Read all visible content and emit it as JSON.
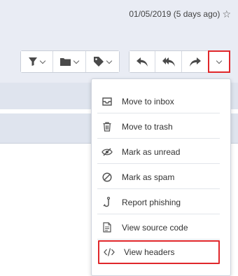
{
  "header": {
    "date": "01/05/2019 (5 days ago)"
  },
  "menu": {
    "items": [
      {
        "label": "Move to inbox",
        "icon": "inbox-icon"
      },
      {
        "label": "Move to trash",
        "icon": "trash-icon"
      },
      {
        "label": "Mark as unread",
        "icon": "eye-slash-icon"
      },
      {
        "label": "Mark as spam",
        "icon": "spam-icon"
      },
      {
        "label": "Report phishing",
        "icon": "hook-icon"
      },
      {
        "label": "View source code",
        "icon": "document-icon"
      },
      {
        "label": "View headers",
        "icon": "code-icon"
      }
    ]
  },
  "colors": {
    "highlight": "#e0272b",
    "band": "#dfe4ee"
  }
}
